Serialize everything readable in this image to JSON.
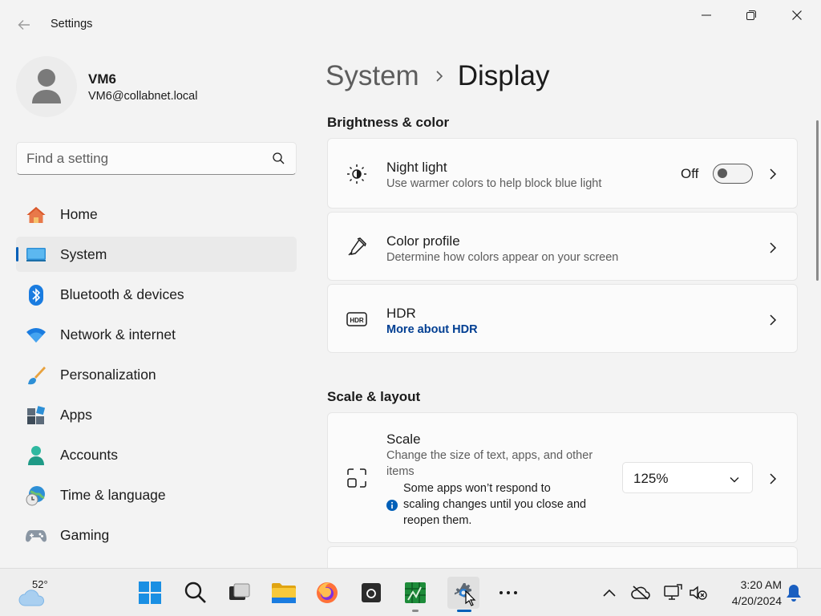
{
  "window": {
    "title": "Settings"
  },
  "profile": {
    "name": "VM6",
    "email": "VM6@collabnet.local"
  },
  "search": {
    "placeholder": "Find a setting"
  },
  "sidebar": {
    "items": [
      {
        "label": "Home",
        "icon": "home-icon",
        "active": false
      },
      {
        "label": "System",
        "icon": "system-monitor-icon",
        "active": true
      },
      {
        "label": "Bluetooth & devices",
        "icon": "bluetooth-icon",
        "active": false
      },
      {
        "label": "Network & internet",
        "icon": "wifi-icon",
        "active": false
      },
      {
        "label": "Personalization",
        "icon": "paintbrush-icon",
        "active": false
      },
      {
        "label": "Apps",
        "icon": "apps-icon",
        "active": false
      },
      {
        "label": "Accounts",
        "icon": "person-icon",
        "active": false
      },
      {
        "label": "Time & language",
        "icon": "globe-clock-icon",
        "active": false
      },
      {
        "label": "Gaming",
        "icon": "gamepad-icon",
        "active": false
      }
    ]
  },
  "breadcrumb": {
    "parent": "System",
    "current": "Display"
  },
  "sections": {
    "brightness": {
      "header": "Brightness & color",
      "night_light": {
        "title": "Night light",
        "description": "Use warmer colors to help block blue light",
        "toggle_label": "Off",
        "enabled": false
      },
      "color_profile": {
        "title": "Color profile",
        "description": "Determine how colors appear on your screen"
      },
      "hdr": {
        "title": "HDR",
        "link": "More about HDR"
      }
    },
    "scale_layout": {
      "header": "Scale & layout",
      "scale": {
        "title": "Scale",
        "description": "Change the size of text, apps, and other items",
        "note": "Some apps won’t respond to scaling changes until you close and reopen them.",
        "value": "125%"
      }
    }
  },
  "taskbar": {
    "weather_temp": "52°",
    "time": "3:20 AM",
    "date": "4/20/2024"
  },
  "colors": {
    "accent": "#005fb8",
    "link": "#003e92",
    "background": "#f3f3f3",
    "card": "#fbfbfb"
  }
}
